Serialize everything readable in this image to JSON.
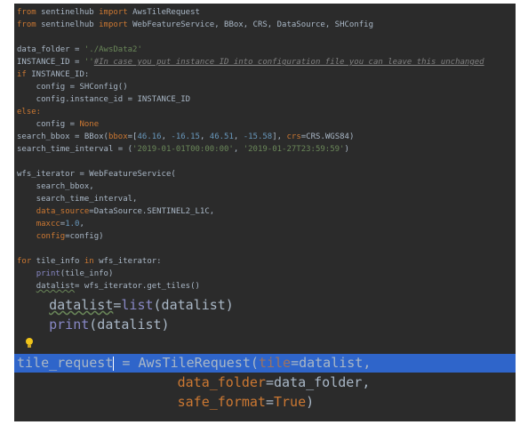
{
  "code": {
    "l1": [
      "from",
      " sentinelhub ",
      "import",
      " AwsTileRequest"
    ],
    "l2": [
      "from",
      " sentinelhub ",
      "import",
      " WebFeatureService, BBox, CRS, DataSource, SHConfig"
    ],
    "l4": [
      "data_folder = ",
      "'./AwsData2'"
    ],
    "l5": [
      "INSTANCE_ID = ",
      "''",
      "#In case you put instance ID into configuration file you can leave this unchanged"
    ],
    "l6": [
      "if",
      " INSTANCE_ID:"
    ],
    "l7": "    config = SHConfig()",
    "l8": "    config.instance_id = INSTANCE_ID",
    "l9": "else:",
    "l10": [
      "    config = ",
      "None"
    ],
    "l11": [
      "search_bbox = BBox(",
      "bbox",
      "=[",
      "46.16",
      ", ",
      "-16.15",
      ", ",
      "46.51",
      ", ",
      "-15.58",
      "], ",
      "crs",
      "=CRS.WGS84)"
    ],
    "l12": [
      "search_time_interval = (",
      "'2019-01-01T00:00:00'",
      ", ",
      "'2019-01-27T23:59:59'",
      ")"
    ],
    "l14": "wfs_iterator = WebFeatureService(",
    "l15": "    search_bbox,",
    "l16": "    search_time_interval,",
    "l17": [
      "    ",
      "data_source",
      "=DataSource.SENTINEL2_L1C,"
    ],
    "l18": [
      "    ",
      "maxcc",
      "=",
      "1.0",
      ","
    ],
    "l19": [
      "    ",
      "config",
      "=config)"
    ],
    "l21": [
      "for",
      " tile_info ",
      "in",
      " wfs_iterator:"
    ],
    "l22": [
      "    ",
      "print",
      "(tile_info)"
    ],
    "l23": [
      "    ",
      "datalist",
      "= wfs_iterator.get_tiles()"
    ],
    "b1": [
      "    ",
      "datalist",
      "=",
      "list",
      "(datalist)"
    ],
    "b2": [
      "    ",
      "print",
      "(datalist)"
    ],
    "b3": [
      "tile_request",
      " = AwsTileRequest(",
      "tile",
      "=datalist,"
    ],
    "b4": [
      "                    ",
      "data_folder",
      "=data_folder,"
    ],
    "b5": [
      "                    ",
      "safe_format",
      "=",
      "True",
      ")"
    ]
  },
  "colors": {
    "background": "#2b2b2b",
    "selection": "#2f65ca",
    "keyword": "#cc7832",
    "string": "#6a8759",
    "number": "#6897bb",
    "comment": "#808080",
    "text": "#a9b7c6"
  },
  "icons": {
    "intention": "lightbulb-icon"
  }
}
